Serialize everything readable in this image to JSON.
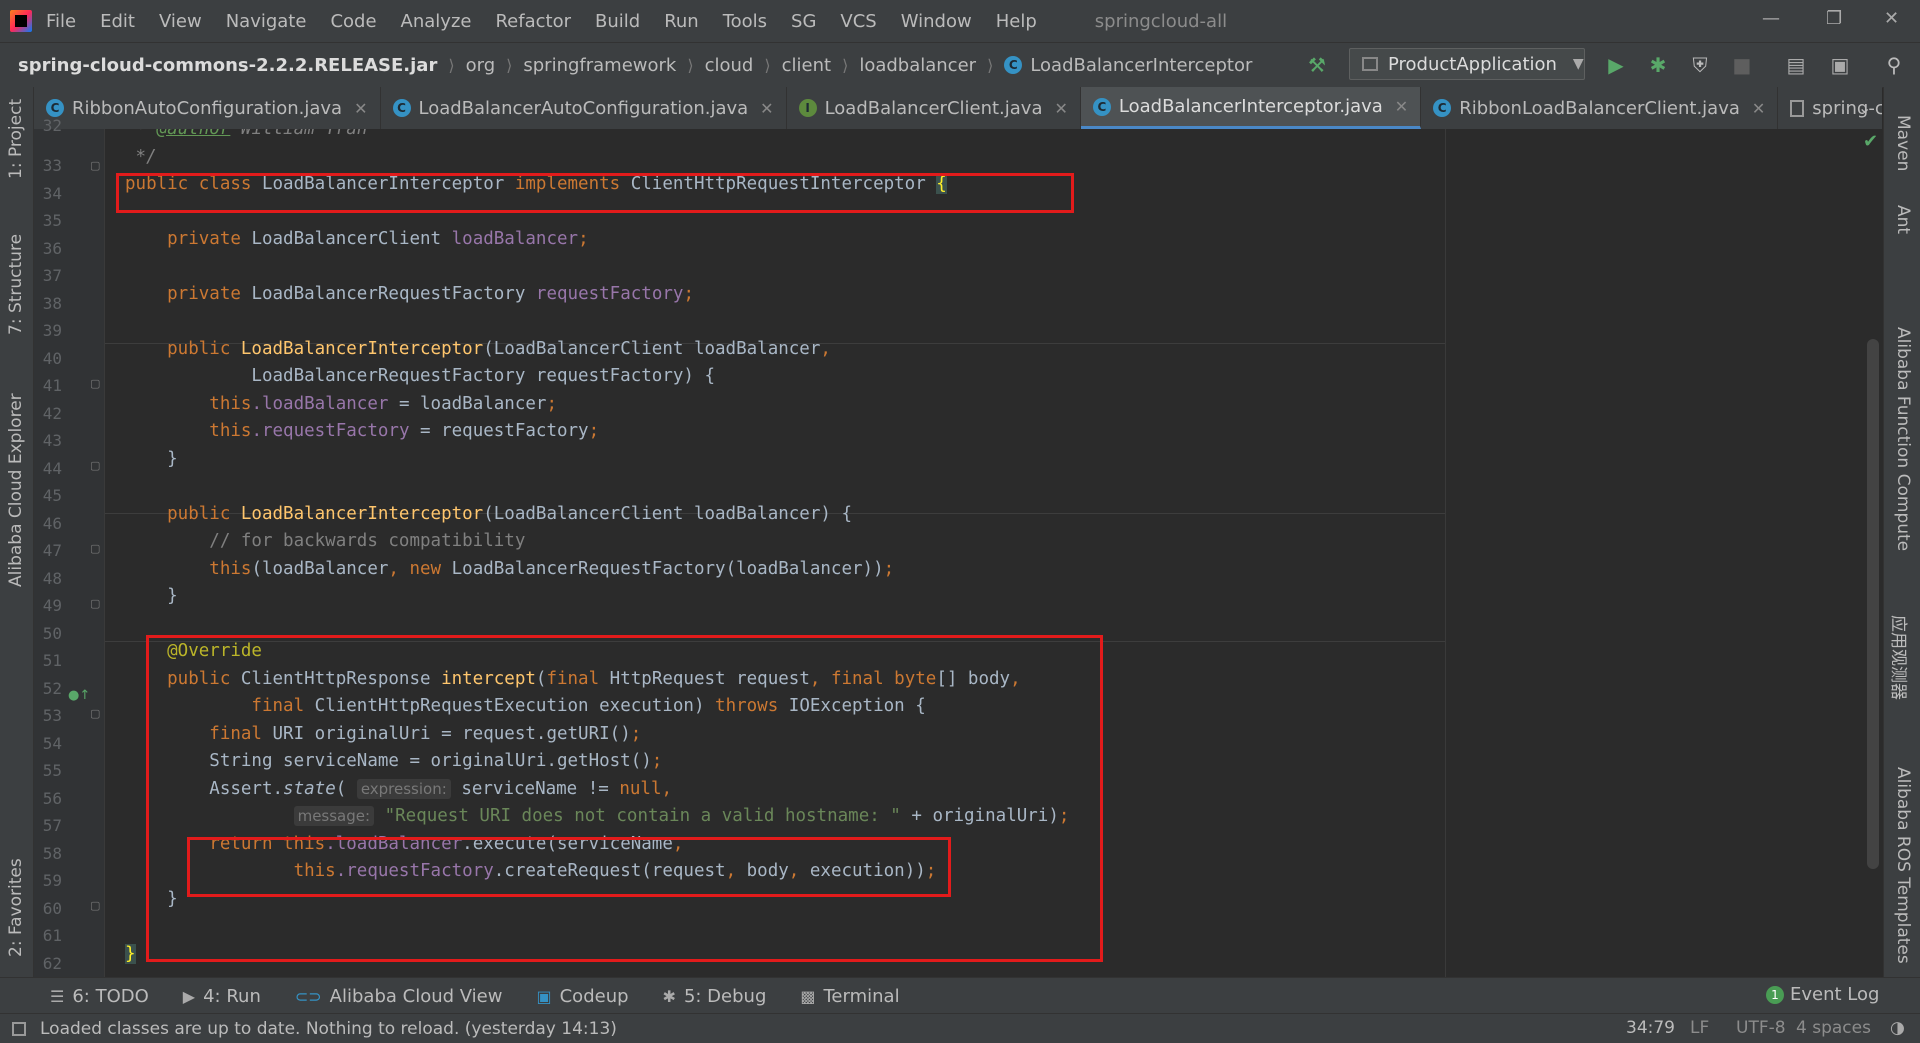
{
  "window": {
    "title": "springcloud-all",
    "menu": [
      "File",
      "Edit",
      "View",
      "Navigate",
      "Code",
      "Analyze",
      "Refactor",
      "Build",
      "Run",
      "Tools",
      "SG",
      "VCS",
      "Window",
      "Help"
    ]
  },
  "breadcrumbs": [
    "spring-cloud-commons-2.2.2.RELEASE.jar",
    "org",
    "springframework",
    "cloud",
    "client",
    "loadbalancer",
    "LoadBalancerInterceptor"
  ],
  "run_config": "ProductApplication",
  "tabs": [
    {
      "label": "RibbonAutoConfiguration.java",
      "kind": "class",
      "active": false
    },
    {
      "label": "LoadBalancerAutoConfiguration.java",
      "kind": "class",
      "active": false
    },
    {
      "label": "LoadBalancerClient.java",
      "kind": "interface",
      "active": false
    },
    {
      "label": "LoadBalancerInterceptor.java",
      "kind": "class",
      "active": true
    },
    {
      "label": "RibbonLoadBalancerClient.java",
      "kind": "class",
      "active": false
    },
    {
      "label": "spring-cloud-starter-",
      "kind": "file",
      "active": false
    }
  ],
  "left_tools": [
    "1: Project",
    "7: Structure",
    "Alibaba Cloud Explorer",
    "2: Favorites"
  ],
  "right_tools": [
    "Maven",
    "Ant",
    "Alibaba Function Compute",
    "应用观测器",
    "Alibaba ROS Templates"
  ],
  "line_numbers": [
    "32",
    "33",
    "34",
    "35",
    "36",
    "37",
    "38",
    "39",
    "40",
    "41",
    "42",
    "43",
    "44",
    "45",
    "46",
    "47",
    "48",
    "49",
    "50",
    "51",
    "52",
    "53",
    "54",
    "55",
    "56",
    "57",
    "58",
    "59",
    "60",
    "61",
    "62"
  ],
  "code": {
    "l32_pre": " * ",
    "l32_tag": "@author",
    "l32_rest": " William Tran",
    "l33": " */",
    "l34_kw1": "public class",
    "l34_name": " LoadBalancerInterceptor ",
    "l34_kw2": "implements",
    "l34_iface": " ClientHttpRequestInterceptor ",
    "l34_brace": "{",
    "l36_kw": "    private",
    "l36_type": " LoadBalancerClient ",
    "l36_fld": "loadBalancer",
    "l36_semi": ";",
    "l38_kw": "    private",
    "l38_type": " LoadBalancerRequestFactory ",
    "l38_fld": "requestFactory",
    "l38_semi": ";",
    "l40_kw": "    public",
    "l40_fn": " LoadBalancerInterceptor",
    "l40_rest": "(LoadBalancerClient loadBalancer",
    "l40_comma": ",",
    "l41": "            LoadBalancerRequestFactory requestFactory) {",
    "l42_kw": "        this",
    "l42_fld": ".loadBalancer",
    "l42_rest": " = loadBalancer",
    "l42_semi": ";",
    "l43_kw": "        this",
    "l43_fld": ".requestFactory",
    "l43_rest": " = requestFactory",
    "l43_semi": ";",
    "l44": "    }",
    "l46_kw": "    public",
    "l46_fn": " LoadBalancerInterceptor",
    "l46_rest": "(LoadBalancerClient loadBalancer) {",
    "l47": "        // for backwards compatibility",
    "l48_kw": "        this",
    "l48_a": "(loadBalancer",
    "l48_comma": ", ",
    "l48_new": "new",
    "l48_b": " LoadBalancerRequestFactory(loadBalancer))",
    "l48_semi": ";",
    "l49": "    }",
    "l51": "    @Override",
    "l52_kw": "    public",
    "l52_type": " ClientHttpResponse ",
    "l52_fn": "intercept",
    "l52_a": "(",
    "l52_final1": "final",
    "l52_b": " HttpRequest request",
    "l52_c": ", ",
    "l52_final2": "final",
    "l52_byte": " byte",
    "l52_d": "[] body",
    "l52_e": ",",
    "l53_final": "            final",
    "l53_a": " ClientHttpRequestExecution execution) ",
    "l53_throws": "throws",
    "l53_b": " IOException {",
    "l54_final": "        final",
    "l54_a": " URI originalUri = request.getURI()",
    "l54_semi": ";",
    "l55_a": "        String serviceName = originalUri.getHost()",
    "l55_semi": ";",
    "l56_a": "        Assert.",
    "l56_state": "state",
    "l56_b": "( ",
    "l56_hint": "expression:",
    "l56_c": " serviceName != ",
    "l56_null": "null",
    "l56_d": ",",
    "l57_pad": "                ",
    "l57_hint": "message:",
    "l57_str": " \"Request URI does not contain a valid hostname: \"",
    "l57_rest": " + originalUri)",
    "l57_semi": ";",
    "l58_ret": "        return this",
    "l58_fld": ".loadBalancer",
    "l58_rest": ".execute(serviceName",
    "l58_comma": ",",
    "l59_this": "                this",
    "l59_fld": ".requestFactory",
    "l59_a": ".createRequest(request",
    "l59_c1": ", ",
    "l59_b": "body",
    "l59_c2": ", ",
    "l59_d": "execution))",
    "l59_semi": ";",
    "l60": "    }",
    "l62": "}"
  },
  "bottom_tools": [
    {
      "label": "6: TODO",
      "icon": "list-icon"
    },
    {
      "label": "4: Run",
      "icon": "play-icon"
    },
    {
      "label": "Alibaba Cloud View",
      "icon": "alibaba-icon"
    },
    {
      "label": "Codeup",
      "icon": "codeup-icon"
    },
    {
      "label": "5: Debug",
      "icon": "bug-icon"
    },
    {
      "label": "Terminal",
      "icon": "terminal-icon"
    }
  ],
  "event_log": {
    "count": "1",
    "label": "Event Log"
  },
  "status": {
    "message": "Loaded classes are up to date. Nothing to reload. (yesterday 14:13)",
    "position": "34:79",
    "line_sep": "LF",
    "encoding": "UTF-8",
    "indent": "4 spaces"
  },
  "colors": {
    "accent": "#4a88c7",
    "highlight_box": "#e21b1b",
    "keyword": "#cc7832",
    "field": "#9876aa",
    "method": "#ffc66d",
    "string": "#6a8759"
  }
}
